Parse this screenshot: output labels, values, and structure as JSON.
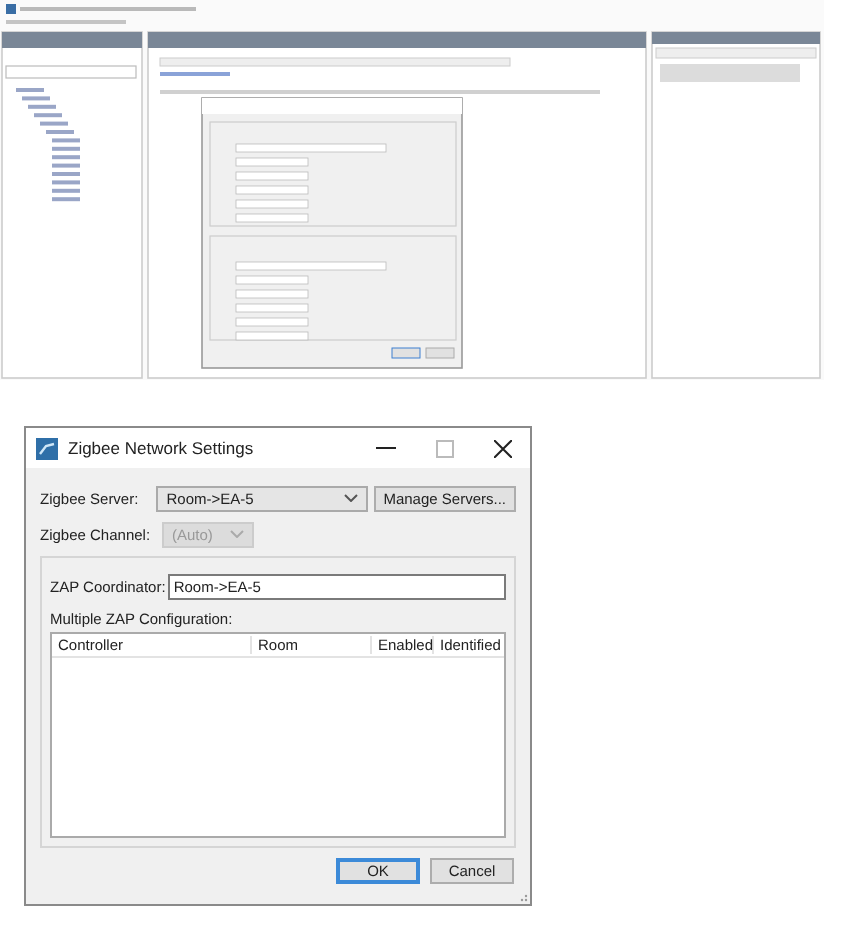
{
  "dialog": {
    "title": "Zigbee Network Settings",
    "server": {
      "label": "Zigbee Server:",
      "value": "Room->EA-5",
      "button": "Manage Servers..."
    },
    "channel": {
      "label": "Zigbee Channel:",
      "value": "(Auto)",
      "disabled": true
    },
    "coordinator": {
      "label": "ZAP Coordinator:",
      "value": "Room->EA-5"
    },
    "multiple_label": "Multiple ZAP Configuration:",
    "columns": [
      "Controller",
      "Room",
      "Enabled",
      "Identified"
    ],
    "buttons": [
      "OK",
      "Cancel"
    ]
  }
}
